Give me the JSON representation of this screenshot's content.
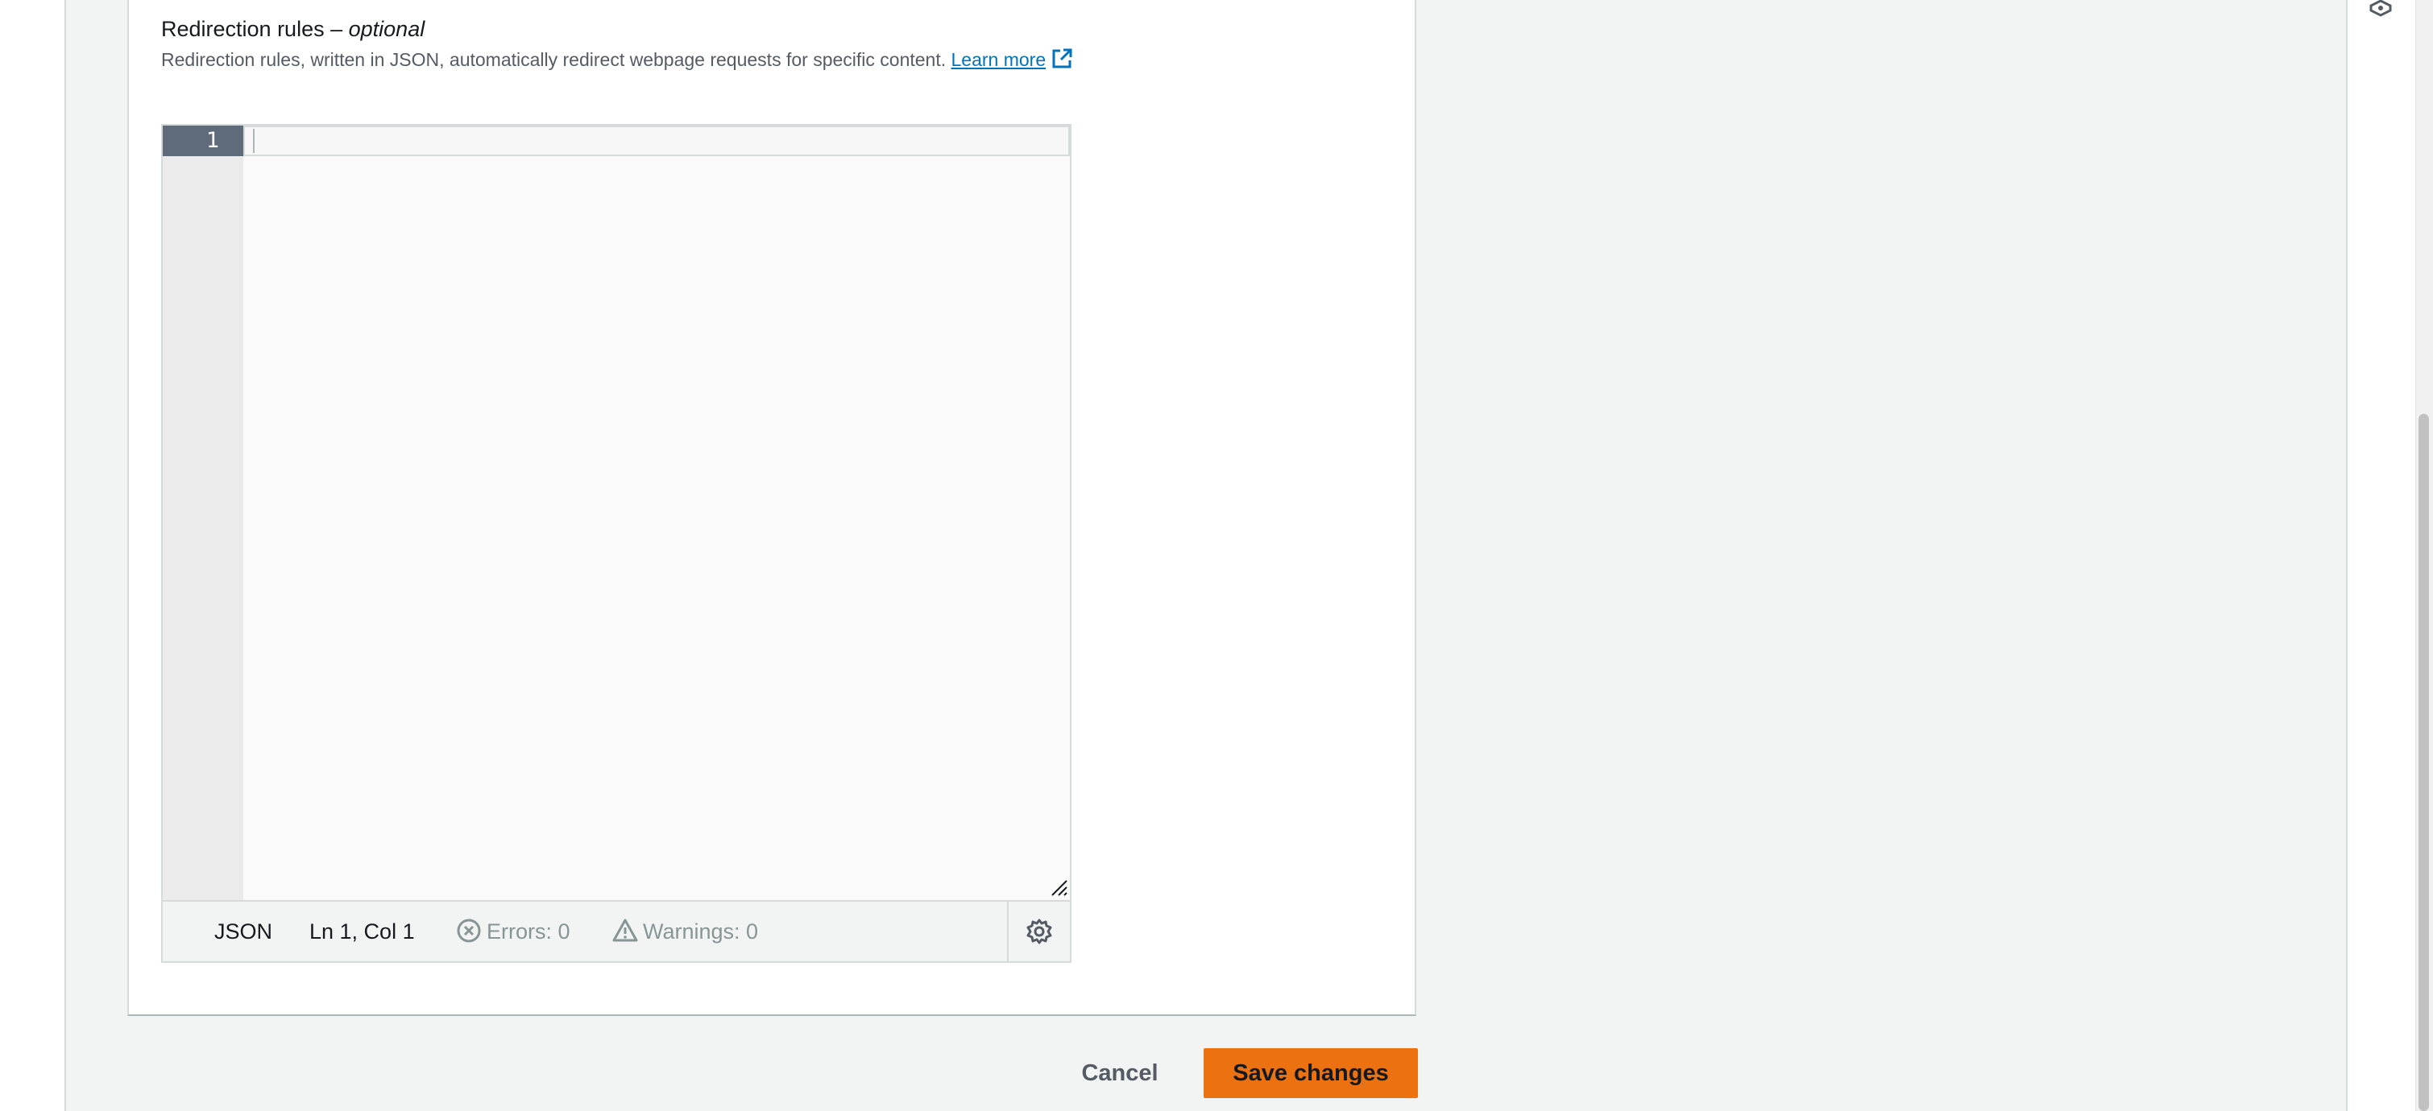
{
  "field": {
    "label": "Redirection rules – ",
    "label_optional": "optional",
    "description": "Redirection rules, written in JSON, automatically redirect webpage requests for specific content. ",
    "learn_more": "Learn more",
    "learn_more_icon": "external-link-icon"
  },
  "editor": {
    "line_number": "1",
    "content": "",
    "status": {
      "language": "JSON",
      "position": "Ln 1, Col 1",
      "errors": "Errors: 0",
      "warnings": "Warnings: 0"
    },
    "icons": {
      "errors": "error-circle-icon",
      "warnings": "warning-triangle-icon",
      "settings": "gear-icon",
      "resize": "resize-handle-icon"
    }
  },
  "actions": {
    "cancel_label": "Cancel",
    "save_label": "Save changes"
  },
  "colors": {
    "primary_button": "#ec7211",
    "link": "#0073bb",
    "active_line_number_bg": "#5f6b7a"
  },
  "top_right_icon": "help-icon"
}
